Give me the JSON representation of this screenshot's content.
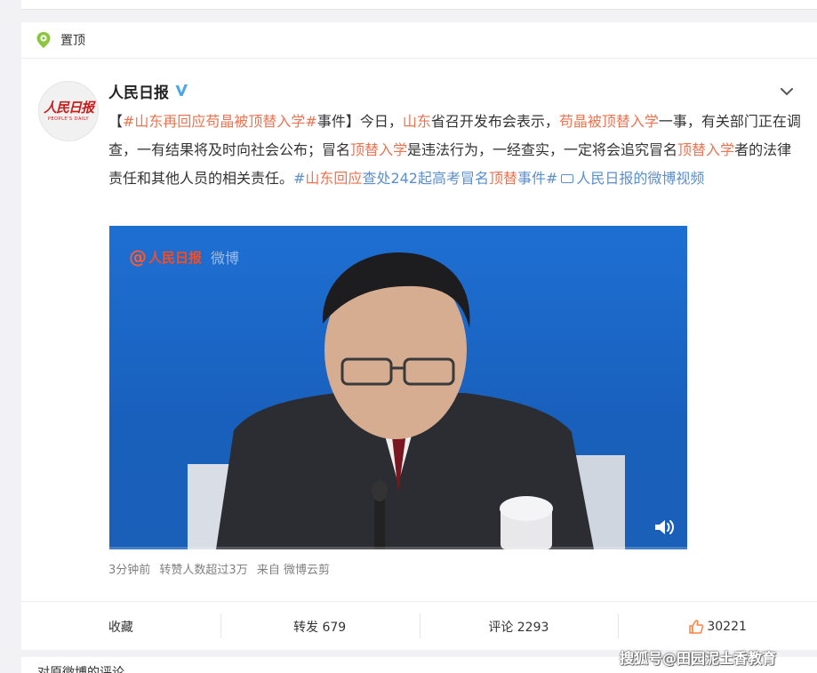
{
  "pin": {
    "label": "置顶",
    "icon": "pin-icon"
  },
  "author": {
    "name": "人民日报",
    "verified": true,
    "avatar_logo": "人民日报",
    "avatar_sub": "PEOPLE'S DAILY"
  },
  "post": {
    "segments": [
      {
        "text": "【",
        "style": "plain"
      },
      {
        "text": "#山东再回应苟晶被顶替入学#",
        "style": "topic"
      },
      {
        "text": "事件】今日，",
        "style": "plain"
      },
      {
        "text": "山东",
        "style": "topic"
      },
      {
        "text": "省召开发布会表示，",
        "style": "plain"
      },
      {
        "text": "苟晶被顶替入学",
        "style": "topic"
      },
      {
        "text": "一事，有关部门正在调查，一有结果将及时向社会公布；冒名",
        "style": "plain"
      },
      {
        "text": "顶替入学",
        "style": "topic"
      },
      {
        "text": "是违法行为，一经查实，一定将会追究冒名",
        "style": "plain"
      },
      {
        "text": "顶替入学",
        "style": "topic"
      },
      {
        "text": "者的法律责任和其他人员的相关责任。",
        "style": "plain"
      },
      {
        "text": "#",
        "style": "link"
      },
      {
        "text": "山东回应",
        "style": "topic"
      },
      {
        "text": "查处242起高考冒名",
        "style": "link"
      },
      {
        "text": "顶替",
        "style": "topic"
      },
      {
        "text": "事件#",
        "style": "link"
      },
      {
        "text": "人民日报的微博视频",
        "style": "link"
      }
    ]
  },
  "video": {
    "watermark_at": "@",
    "watermark_name": "人民日报",
    "watermark_weibo": "微博",
    "progress": 0.0,
    "volume_icon": "volume-icon",
    "colors": {
      "background": "#1b66c4"
    }
  },
  "meta": {
    "time": "3分钟前",
    "reposts_note": "转赞人数超过3万",
    "source": "来自 微博云剪"
  },
  "actions": {
    "favorite": "收藏",
    "repost": "转发 679",
    "comment": "评论 2293",
    "like_count": "30221"
  },
  "below": {
    "text": "对原微博的评论"
  },
  "source_watermark": "搜狐号@田园泥土香教育",
  "colors": {
    "topic": "#eb7350",
    "link": "#5b8fcb",
    "like": "#ff8140"
  }
}
